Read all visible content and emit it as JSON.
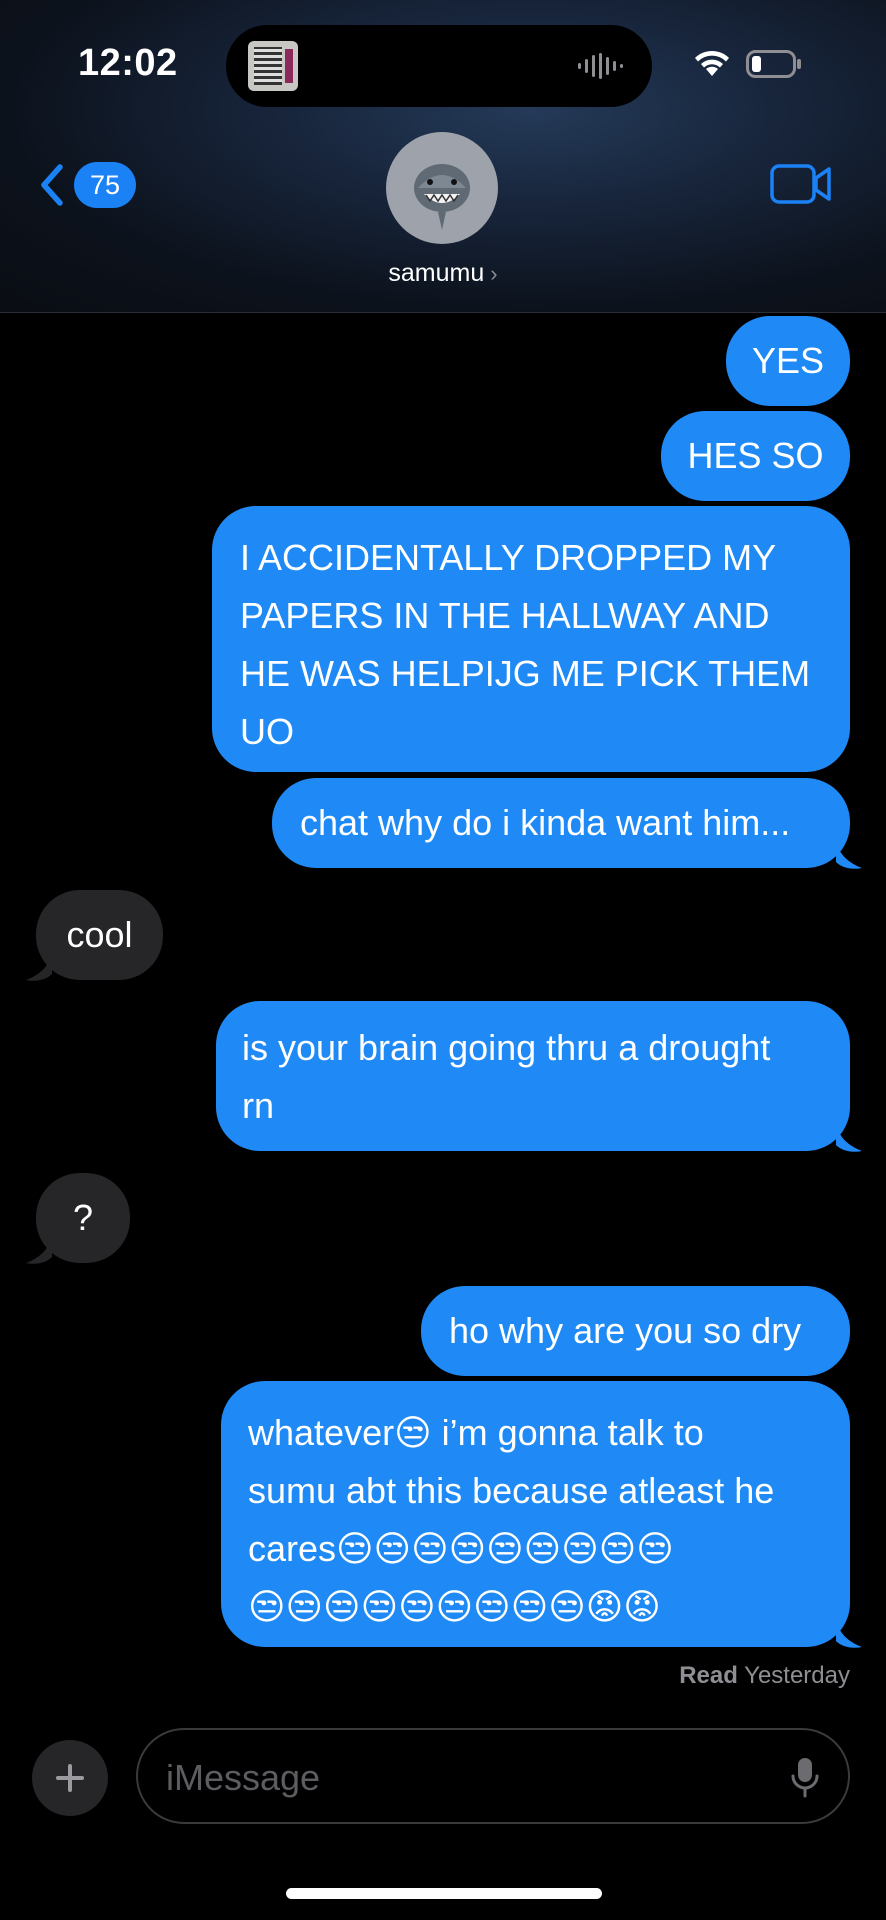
{
  "status": {
    "time": "12:02"
  },
  "header": {
    "back_count": "75",
    "contact_name": "samumu",
    "chevron": "›"
  },
  "messages": [
    {
      "text": "YES"
    },
    {
      "text": "HES SO"
    },
    {
      "lines": [
        "I ACCIDENTALLY DROPPED MY",
        "PAPERS IN THE HALLWAY AND",
        "HE WAS HELPIJG ME PICK THEM",
        "UO"
      ]
    },
    {
      "text": "chat why do i kinda want him..."
    },
    {
      "text": "cool"
    },
    {
      "lines": [
        "is your brain going thru a drought",
        "rn"
      ]
    },
    {
      "text": "?"
    },
    {
      "text": "ho why are you so dry"
    },
    {
      "lines": [
        "whatever😒 i’m gonna talk to",
        "sumu abt this because atleast he",
        "cares😒😒😒😒😒😒😒😒😒",
        "😒😒😒😒😒😒😒😒😒😡😡"
      ]
    }
  ],
  "receipt": {
    "label": "Read",
    "time": "Yesterday"
  },
  "composer": {
    "placeholder": "iMessage"
  },
  "colors": {
    "outgoing": "#1f8af5",
    "incoming": "#262628",
    "accent": "#1a82f5"
  }
}
